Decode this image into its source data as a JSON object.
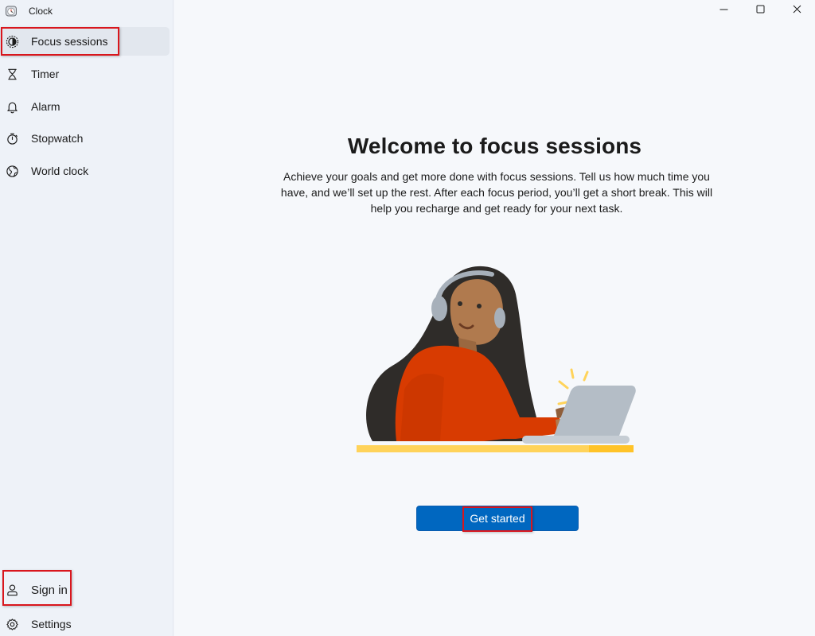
{
  "app": {
    "title": "Clock"
  },
  "sidebar": {
    "items": [
      {
        "label": "Focus sessions",
        "icon": "focus-icon",
        "selected": true
      },
      {
        "label": "Timer",
        "icon": "hourglass-icon",
        "selected": false
      },
      {
        "label": "Alarm",
        "icon": "bell-icon",
        "selected": false
      },
      {
        "label": "Stopwatch",
        "icon": "stopwatch-icon",
        "selected": false
      },
      {
        "label": "World clock",
        "icon": "globe-icon",
        "selected": false
      }
    ],
    "footer": [
      {
        "label": "Sign in",
        "icon": "person-icon"
      },
      {
        "label": "Settings",
        "icon": "gear-icon"
      }
    ]
  },
  "window_controls": {
    "minimize": "minimize-icon",
    "maximize": "maximize-icon",
    "close": "close-icon"
  },
  "main": {
    "title": "Welcome to focus sessions",
    "description": "Achieve your goals and get more done with focus sessions. Tell us how much time you have, and we’ll set up the rest. After each focus period, you’ll get a short break. This will help you recharge and get ready for your next task.",
    "illustration": "person-with-headphones-at-laptop",
    "primary_button": "Get started"
  },
  "colors": {
    "accent": "#0067c0",
    "highlight_box": "#d9161d",
    "sidebar_bg": "#eef2f8",
    "main_bg": "#f6f8fb"
  }
}
